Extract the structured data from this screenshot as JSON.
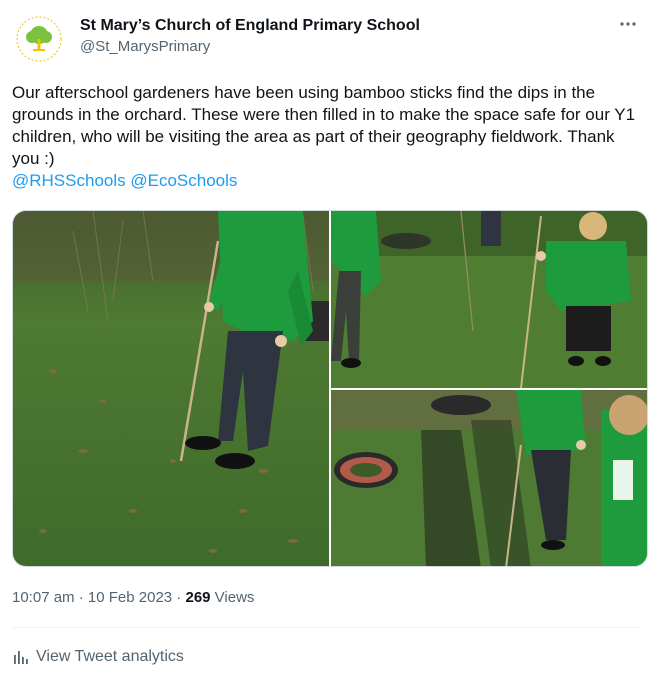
{
  "author": {
    "display_name": "St Mary’s Church of England Primary School",
    "handle": "@St_MarysPrimary",
    "avatar_icon": "school-tree-logo"
  },
  "tweet": {
    "text": "Our afterschool gardeners have been using bamboo sticks find the dips in the grounds in the orchard. These were then filled in to make the space safe for our Y1 children, who will be visiting the area as part of their geography fieldwork. Thank you :)",
    "mentions": [
      "@RHSSchools",
      "@EcoSchools"
    ]
  },
  "media": {
    "photos": [
      {
        "description_icon": "photo-child-with-bamboo-stick"
      },
      {
        "description_icon": "photo-children-in-grass"
      },
      {
        "description_icon": "photo-tyre-and-shadows"
      }
    ]
  },
  "meta": {
    "time": "10:07 am",
    "separator": " · ",
    "date": "10 Feb 2023",
    "view_count": "269",
    "views_label": " Views"
  },
  "actions": {
    "analytics_label": "View Tweet analytics",
    "more_icon": "more-horizontal-icon",
    "analytics_icon": "bar-chart-icon"
  },
  "colors": {
    "link": "#1d9bf0",
    "secondary_text": "#536471",
    "primary_text": "#0f1419",
    "uniform_green": "#1e9b3c"
  }
}
